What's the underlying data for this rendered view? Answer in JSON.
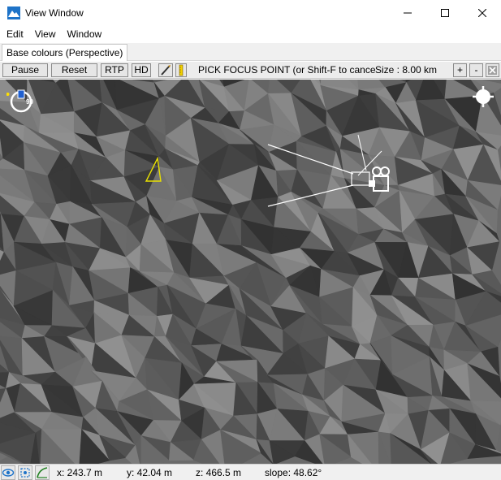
{
  "window": {
    "title": "View Window",
    "minimize_glyph": "—",
    "maximize_glyph": "☐",
    "close_glyph": "✕"
  },
  "menu": [
    "Edit",
    "View",
    "Window"
  ],
  "tab": {
    "label": "Base colours (Perspective)"
  },
  "toolbar": {
    "pause": "Pause",
    "reset": "Reset",
    "rtp": "RTP",
    "hd": "HD",
    "status": "PICK FOCUS POINT (or Shift-F to cance",
    "size": "Size :  8.00 km",
    "plus": "+",
    "minus": "-"
  },
  "compass": {
    "value": "90"
  },
  "status": {
    "x": "x: 243.7 m",
    "y": "y: 42.04 m",
    "z": "z: 466.5 m",
    "slope": "slope: 48.62°"
  },
  "colors": {
    "accent": "#1e73c8",
    "marker": "#e8e000",
    "camera_lines": "#ffffff",
    "terrain": "#6a6a6a"
  }
}
